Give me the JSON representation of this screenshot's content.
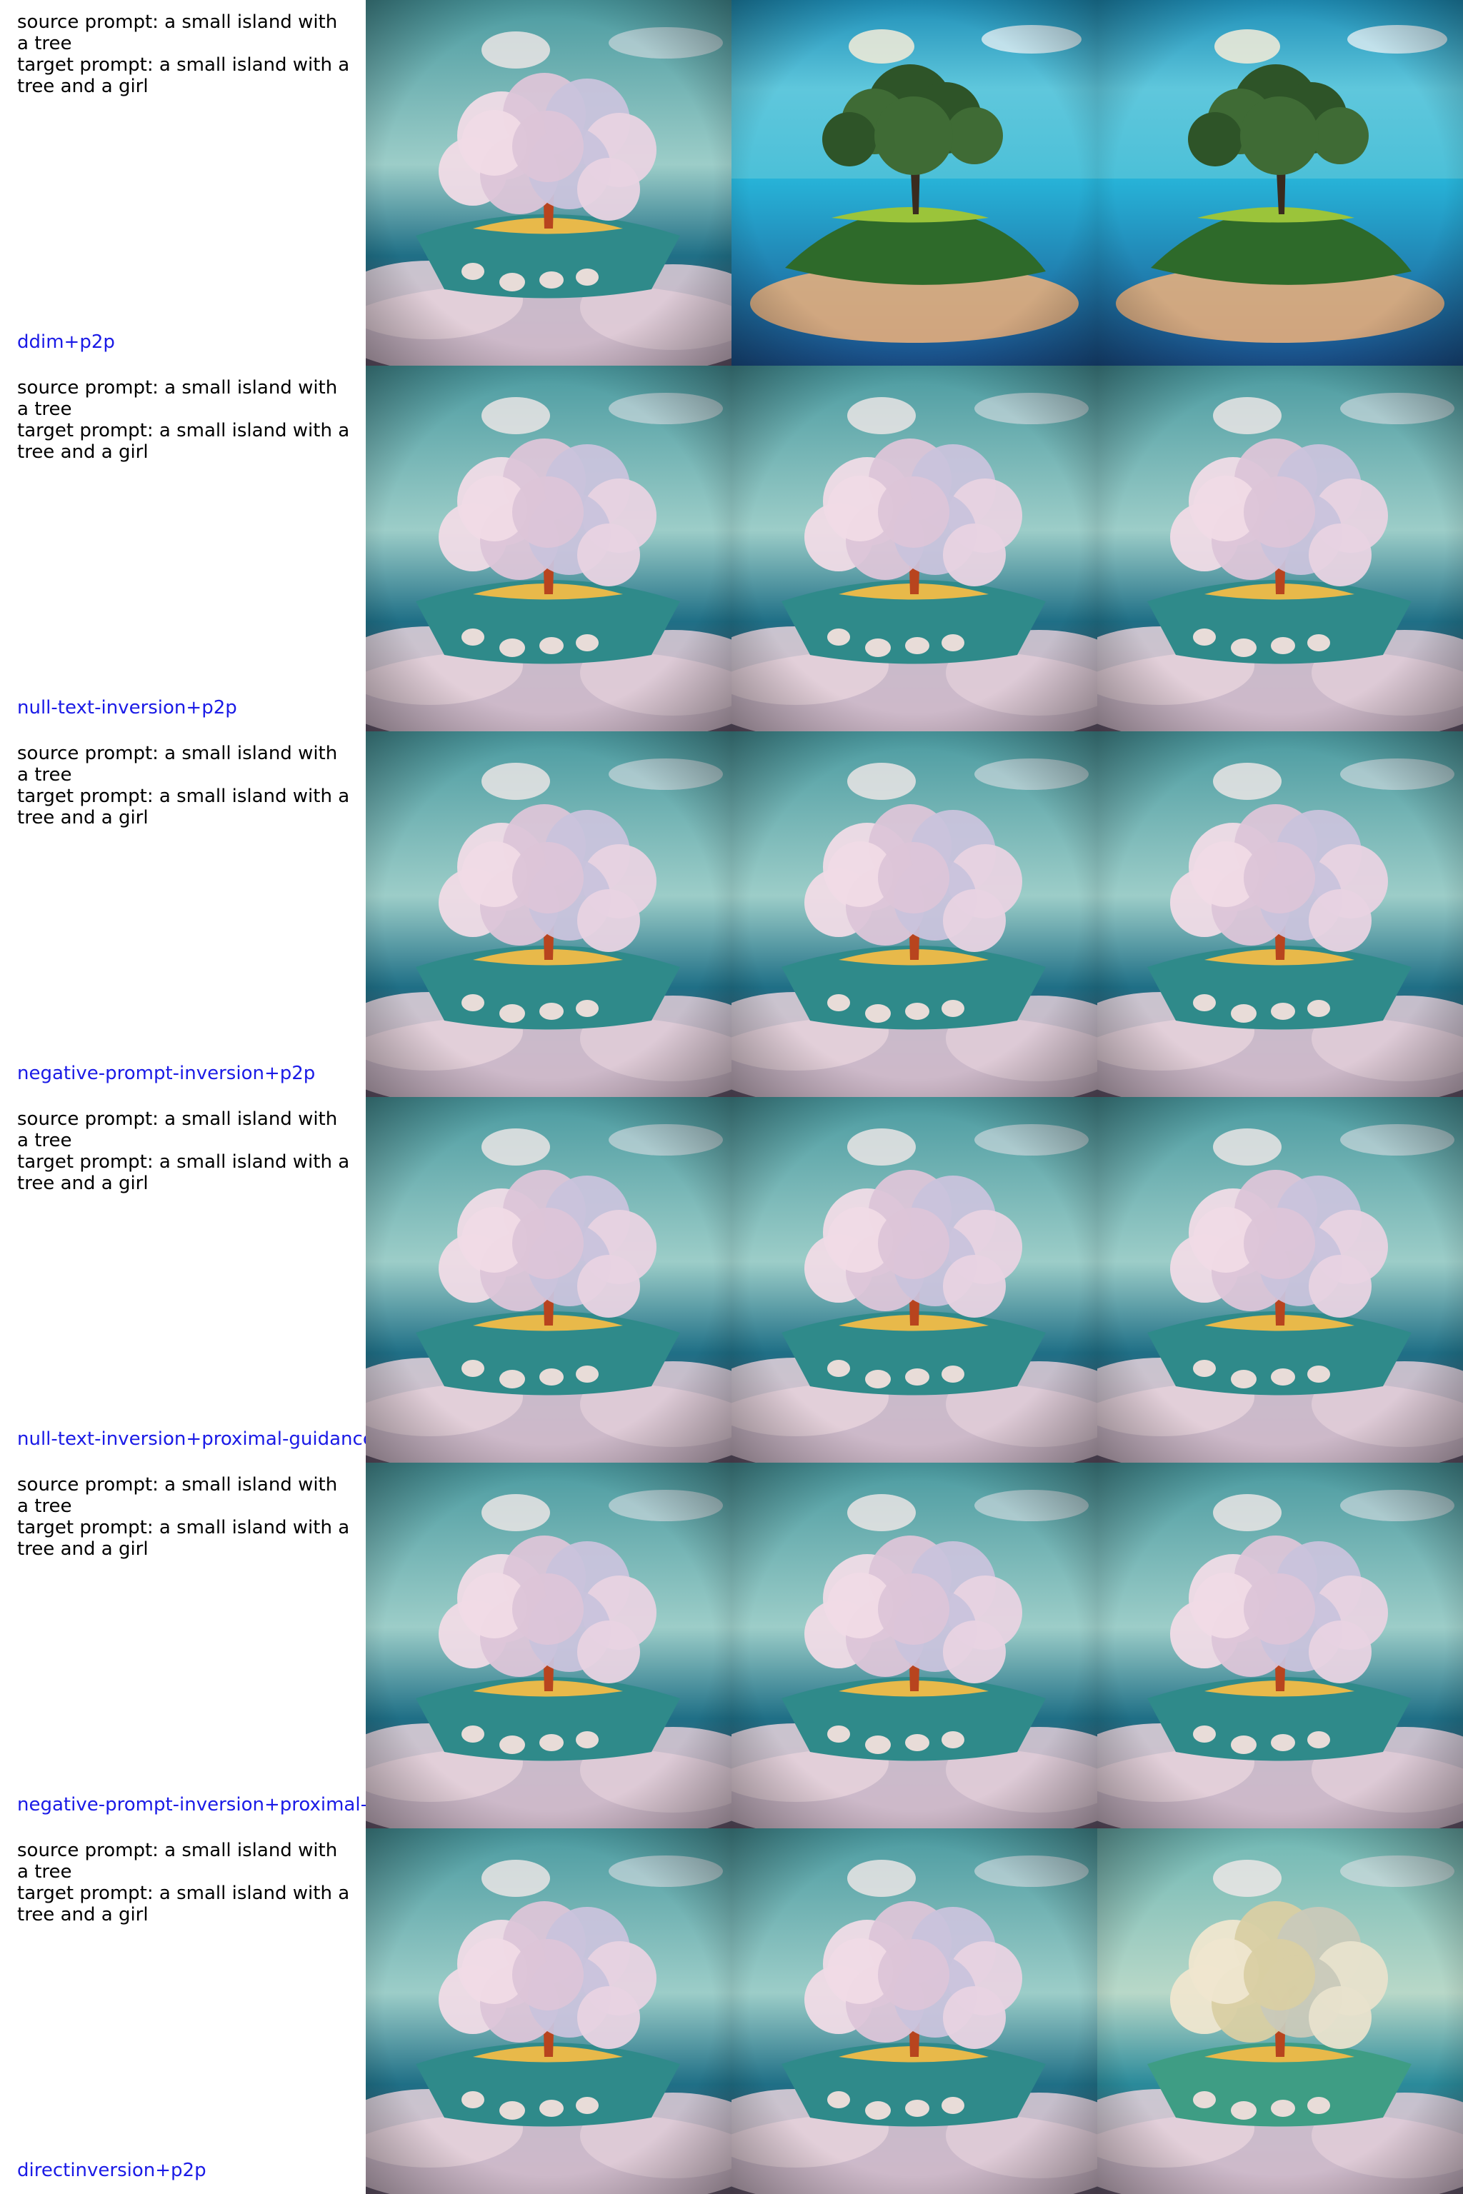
{
  "label_color": "#1a1ae6",
  "rows": [
    {
      "method": "ddim+p2p",
      "source_prompt": "source prompt: a small island with a tree",
      "target_prompt": "target prompt: a small island with a tree and a girl",
      "images": [
        {
          "name": "source-image",
          "style": "fluffy"
        },
        {
          "name": "reconstruction-image",
          "style": "real"
        },
        {
          "name": "edited-image",
          "style": "real"
        }
      ]
    },
    {
      "method": "null-text-inversion+p2p",
      "source_prompt": "source prompt: a small island with a tree",
      "target_prompt": "target prompt: a small island with a tree and a girl",
      "images": [
        {
          "name": "source-image",
          "style": "fluffy"
        },
        {
          "name": "reconstruction-image",
          "style": "fluffy"
        },
        {
          "name": "edited-image",
          "style": "fluffy"
        }
      ]
    },
    {
      "method": "negative-prompt-inversion+p2p",
      "source_prompt": "source prompt: a small island with a tree",
      "target_prompt": "target prompt: a small island with a tree and a girl",
      "images": [
        {
          "name": "source-image",
          "style": "fluffy"
        },
        {
          "name": "reconstruction-image",
          "style": "fluffy"
        },
        {
          "name": "edited-image",
          "style": "fluffy"
        }
      ]
    },
    {
      "method": "null-text-inversion+proximal-guidance",
      "source_prompt": "source prompt: a small island with a tree",
      "target_prompt": "target prompt: a small island with a tree and a girl",
      "images": [
        {
          "name": "source-image",
          "style": "fluffy"
        },
        {
          "name": "reconstruction-image",
          "style": "fluffy"
        },
        {
          "name": "edited-image",
          "style": "fluffy"
        }
      ]
    },
    {
      "method": "negative-prompt-inversion+proximal-g",
      "source_prompt": "source prompt: a small island with a tree",
      "target_prompt": "target prompt: a small island with a tree and a girl",
      "images": [
        {
          "name": "source-image",
          "style": "fluffy"
        },
        {
          "name": "reconstruction-image",
          "style": "fluffy"
        },
        {
          "name": "edited-image",
          "style": "fluffy"
        }
      ]
    },
    {
      "method": "directinversion+p2p",
      "source_prompt": "source prompt: a small island with a tree",
      "target_prompt": "target prompt: a small island with a tree and a girl",
      "images": [
        {
          "name": "source-image",
          "style": "fluffy"
        },
        {
          "name": "reconstruction-image",
          "style": "fluffy"
        },
        {
          "name": "edited-image",
          "style": "fluffy-yellow"
        }
      ]
    }
  ]
}
